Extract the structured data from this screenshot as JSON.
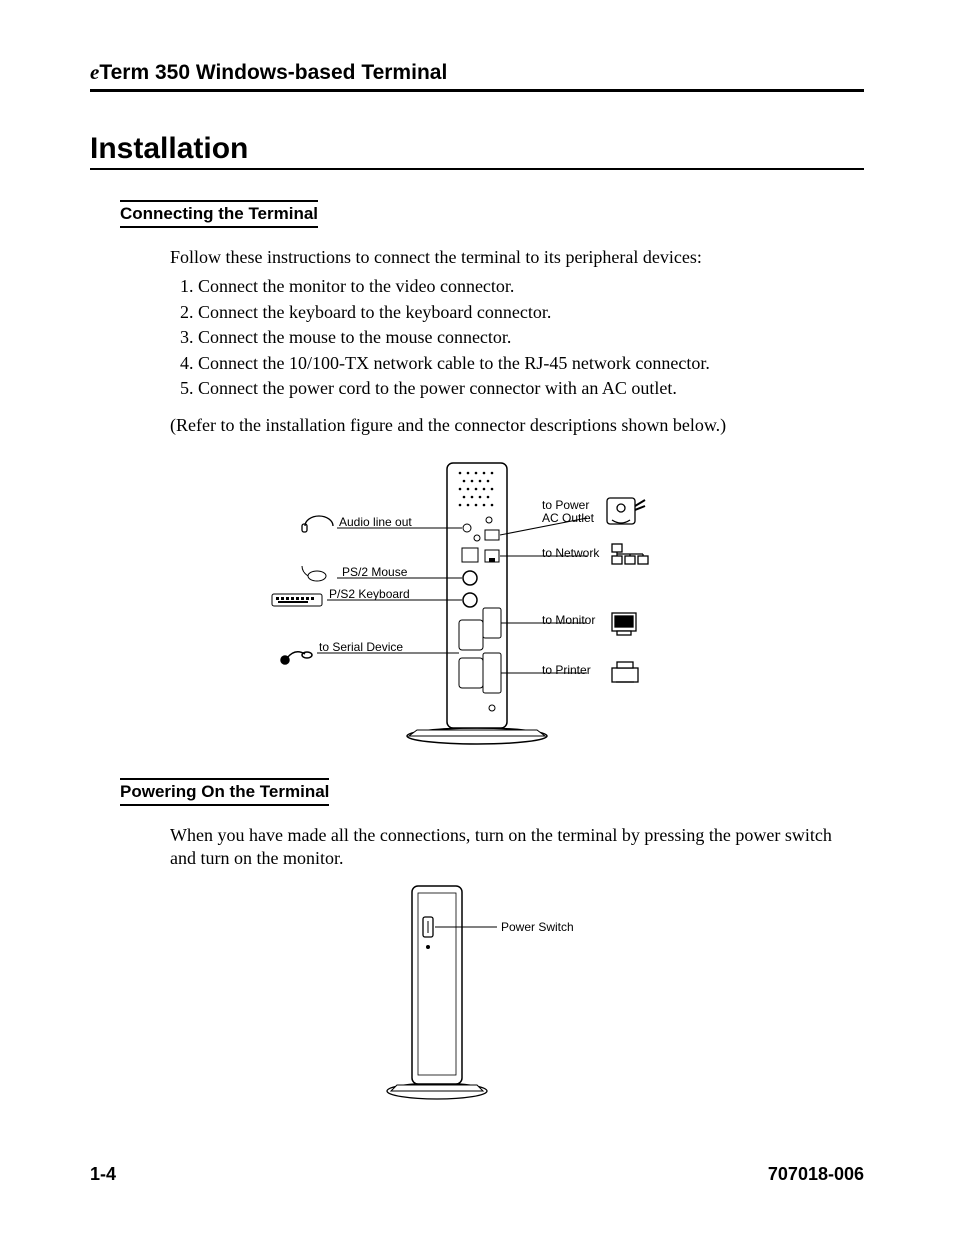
{
  "header": {
    "prefix_italic": "e",
    "title_rest": "Term 350 Windows-based Terminal"
  },
  "section_title": "Installation",
  "connecting": {
    "heading": "Connecting the Terminal",
    "intro": "Follow these instructions to connect the terminal to its peripheral devices:",
    "steps": [
      "Connect the monitor to the video connector.",
      "Connect the keyboard to the keyboard connector.",
      "Connect the mouse to the mouse connector.",
      "Connect the 10/100-TX network cable to the RJ-45 network connector.",
      "Connect the power cord to the power connector with an AC outlet."
    ],
    "note": "(Refer to the installation figure and the connector descriptions shown below.)"
  },
  "figure1_labels": {
    "audio": "Audio line out",
    "mouse": "PS/2 Mouse",
    "keyboard": "P/S2 Keyboard",
    "serial": "to Serial Device",
    "power_line1": "to Power",
    "power_line2": "AC Outlet",
    "network": "to Network",
    "monitor": "to Monitor",
    "printer": "to Printer"
  },
  "powering": {
    "heading": "Powering On the Terminal",
    "text": "When you have made all the connections, turn on the terminal by pressing the power switch and turn on the monitor."
  },
  "figure2_labels": {
    "power_switch": "Power Switch"
  },
  "footer": {
    "page": "1-4",
    "doc": "707018-006"
  }
}
